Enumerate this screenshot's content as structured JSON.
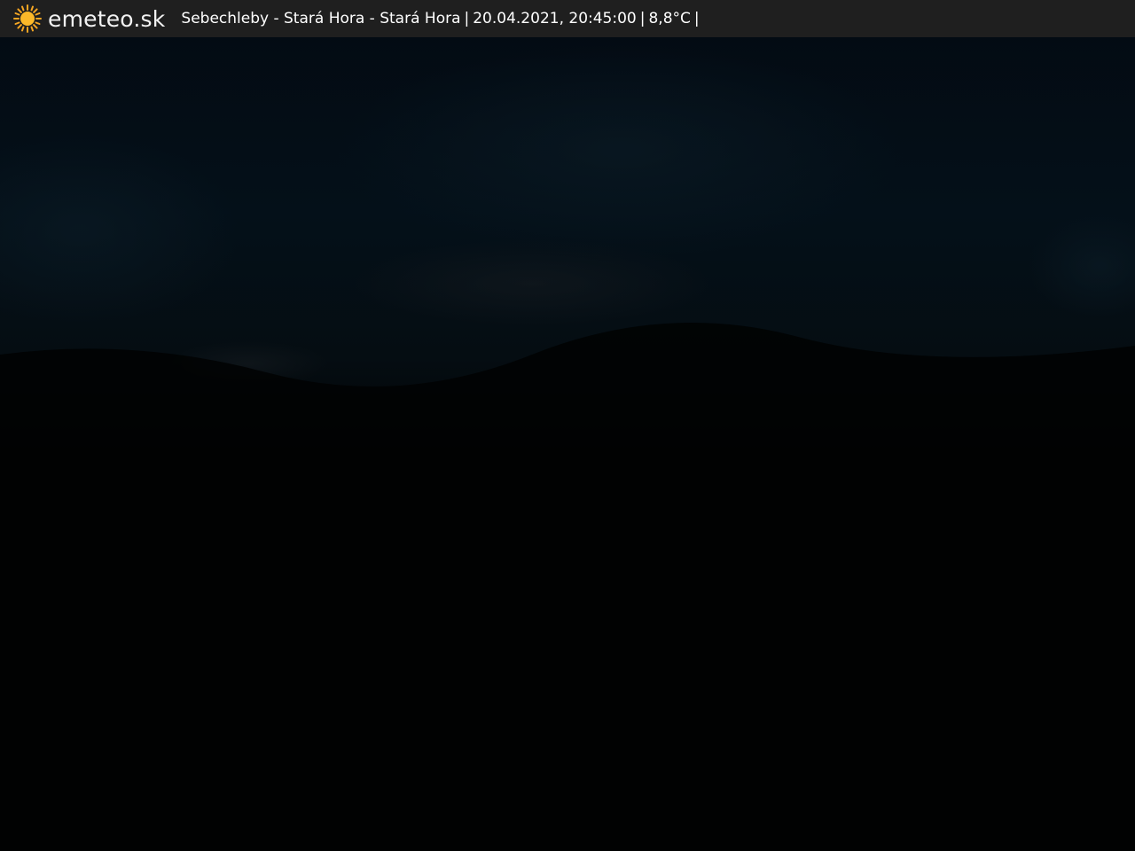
{
  "header": {
    "brand": "emeteo.sk",
    "location": "Sebechleby - Stará Hora - Stará Hora",
    "datetime": "20.04.2021, 20:45:00",
    "temperature": "8,8°C",
    "separator": "|"
  },
  "icons": {
    "logo": "sun-icon"
  },
  "colors": {
    "bar_background": "#1f1f1f",
    "sun": "#f5a623",
    "sky_dark": "#020a12",
    "ground": "#000000"
  }
}
